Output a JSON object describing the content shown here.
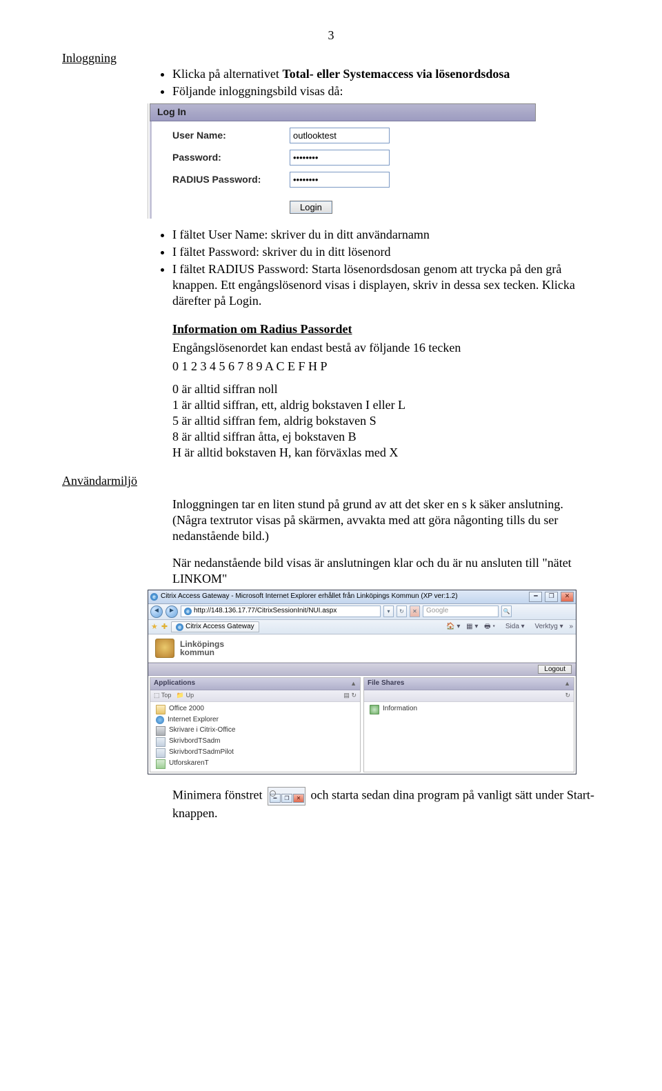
{
  "page_number": "3",
  "headings": {
    "inloggning": "Inloggning",
    "anvandarmiljo": "Användarmiljö",
    "radius_info": "Information om Radius Passordet"
  },
  "bullets1": [
    "Klicka på alternativet Total- eller Systemaccess via lösenordsdosa",
    "Följande inloggningsbild visas då:"
  ],
  "login": {
    "title": "Log In",
    "labels": {
      "user": "User Name:",
      "pass": "Password:",
      "radius": "RADIUS Password:"
    },
    "values": {
      "user": "outlooktest",
      "pass": "••••••••",
      "radius": "••••••••"
    },
    "button": "Login"
  },
  "bullets2_line1": "I fältet User Name: skriver du in ditt användarnamn",
  "bullets2_line2": "I fältet Password: skriver du in ditt lösenord",
  "bullets2_line3": "I fältet RADIUS Password: Starta lösenordsdosan genom att trycka på den grå knappen. Ett engångslösenord visas i displayen, skriv in dessa sex tecken. Klicka därefter på Login.",
  "radius_info_lines": [
    "Engångslösenordet kan endast bestå av följande 16 tecken",
    "0 1 2 3 4 5 6 7 8 9 A C E F H P"
  ],
  "radius_notes": [
    "0 är alltid siffran noll",
    "1 är alltid siffran, ett, aldrig bokstaven I eller L",
    "5 är alltid siffran fem, aldrig bokstaven S",
    "8 är alltid siffran åtta, ej bokstaven B",
    "H är alltid bokstaven H, kan förväxlas med X"
  ],
  "env_para1": "Inloggningen tar en liten stund på grund av att det sker en s k säker anslutning. (Några textrutor visas på skärmen, avvakta med att göra någonting tills du ser nedanstående bild.)",
  "env_para2": "När nedanstående bild visas är anslutningen klar och du är nu ansluten till \"nätet LINKOM\"",
  "shot": {
    "title": "Citrix Access Gateway - Microsoft Internet Explorer erhållet från Linköpings Kommun (XP ver:1.2)",
    "url": "http://148.136.17.77/CitrixSessionInit/NUI.aspx",
    "search_placeholder": "Google",
    "tab": "Citrix Access Gateway",
    "toolbar": {
      "sida": "Sida",
      "verktyg": "Verktyg"
    },
    "brand": {
      "l1": "Linköpings",
      "l2": "kommun"
    },
    "logout": "Logout",
    "panel_apps": "Applications",
    "panel_files": "File Shares",
    "apps_toolbar": {
      "top": "Top",
      "up": "Up"
    },
    "apps": [
      "Office 2000",
      "Internet Explorer",
      "Skrivare i Citrix-Office",
      "SkrivbordTSadm",
      "SkrivbordTSadmPilot",
      "UtforskarenT"
    ],
    "files": [
      "Information"
    ]
  },
  "footer_pre": "Minimera fönstret ",
  "footer_post": " och starta sedan dina program på vanligt sätt under Start-knappen."
}
